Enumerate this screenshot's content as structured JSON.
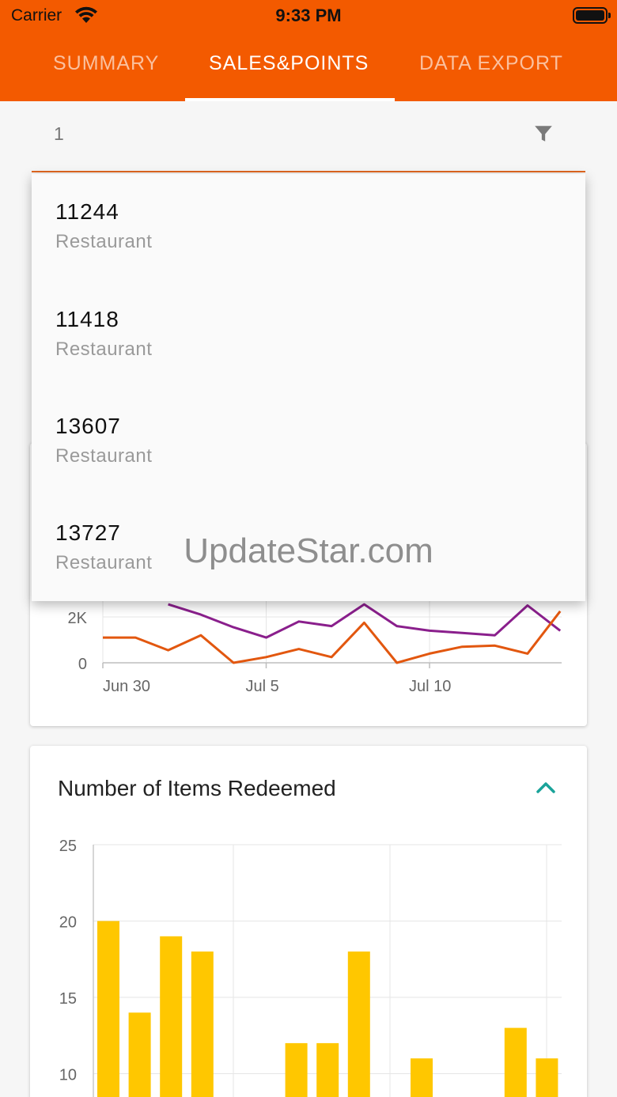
{
  "status_bar": {
    "carrier": "Carrier",
    "time": "9:33 PM"
  },
  "tabs": [
    {
      "label": "SUMMARY",
      "active": false
    },
    {
      "label": "SALES&POINTS",
      "active": true
    },
    {
      "label": "DATA EXPORT",
      "active": false
    }
  ],
  "filter": {
    "value": "1",
    "icon": "filter-icon"
  },
  "dropdown": {
    "items": [
      {
        "code": "11244",
        "type": "Restaurant"
      },
      {
        "code": "11418",
        "type": "Restaurant"
      },
      {
        "code": "13607",
        "type": "Restaurant"
      },
      {
        "code": "13727",
        "type": "Restaurant"
      }
    ]
  },
  "watermark": "UpdateStar.com",
  "colors": {
    "primary": "#f35a00",
    "accent": "#1aa39a",
    "series_purple": "#8a1f8c",
    "series_orange": "#e2570f",
    "bar": "#ffc700"
  },
  "chart_data": [
    {
      "type": "line",
      "title": "",
      "x_tick_labels": [
        "Jun 30",
        "Jul 5",
        "Jul 10"
      ],
      "y_tick_labels": [
        "0",
        "2K"
      ],
      "series": [
        {
          "values": [
            null,
            null,
            2550,
            2100,
            1550,
            1100,
            1800,
            1600,
            2550,
            1600,
            1400,
            1300,
            1200,
            2500,
            1400
          ]
        },
        {
          "values": [
            1100,
            1100,
            550,
            1200,
            0,
            250,
            600,
            250,
            1750,
            0,
            400,
            700,
            750,
            400,
            2250
          ]
        }
      ]
    },
    {
      "type": "bar",
      "title": "Number of Items Redeemed",
      "y_tick_labels": [
        "25",
        "20",
        "15",
        "10"
      ],
      "ylim": [
        0,
        25
      ],
      "values": [
        20,
        14,
        19,
        18,
        null,
        null,
        12,
        12,
        18,
        null,
        11,
        null,
        null,
        13,
        11
      ]
    }
  ]
}
